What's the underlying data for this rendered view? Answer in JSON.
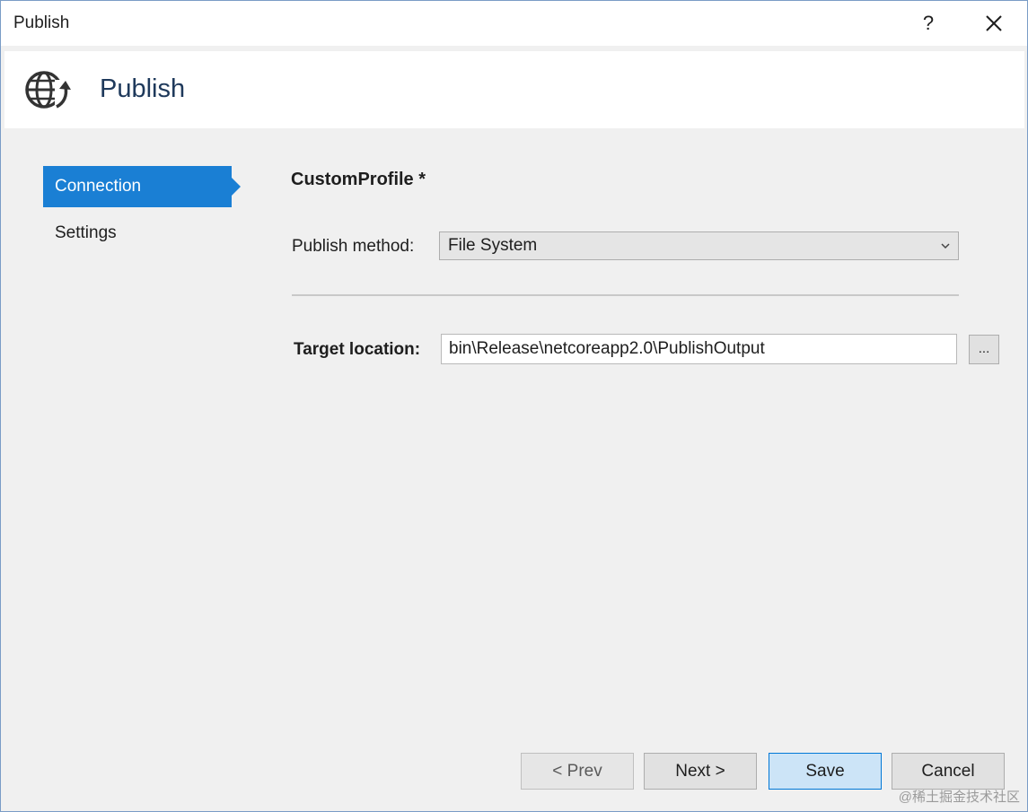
{
  "window": {
    "title": "Publish",
    "help_label": "?",
    "close_icon": "close-icon"
  },
  "header": {
    "title": "Publish",
    "icon": "globe-upload-icon"
  },
  "sidebar": {
    "items": [
      {
        "label": "Connection",
        "active": true
      },
      {
        "label": "Settings",
        "active": false
      }
    ]
  },
  "main": {
    "profile_name": "CustomProfile *",
    "publish_method": {
      "label": "Publish method:",
      "selected": "File System"
    },
    "target_location": {
      "label": "Target location:",
      "value": "bin\\Release\\netcoreapp2.0\\PublishOutput",
      "browse_label": "..."
    }
  },
  "footer": {
    "prev_label": "< Prev",
    "next_label": "Next >",
    "save_label": "Save",
    "cancel_label": "Cancel"
  },
  "watermark": "@稀土掘金技术社区",
  "colors": {
    "accent": "#1a7fd4",
    "primary_button": "#cce4f7",
    "primary_border": "#0078d7"
  }
}
